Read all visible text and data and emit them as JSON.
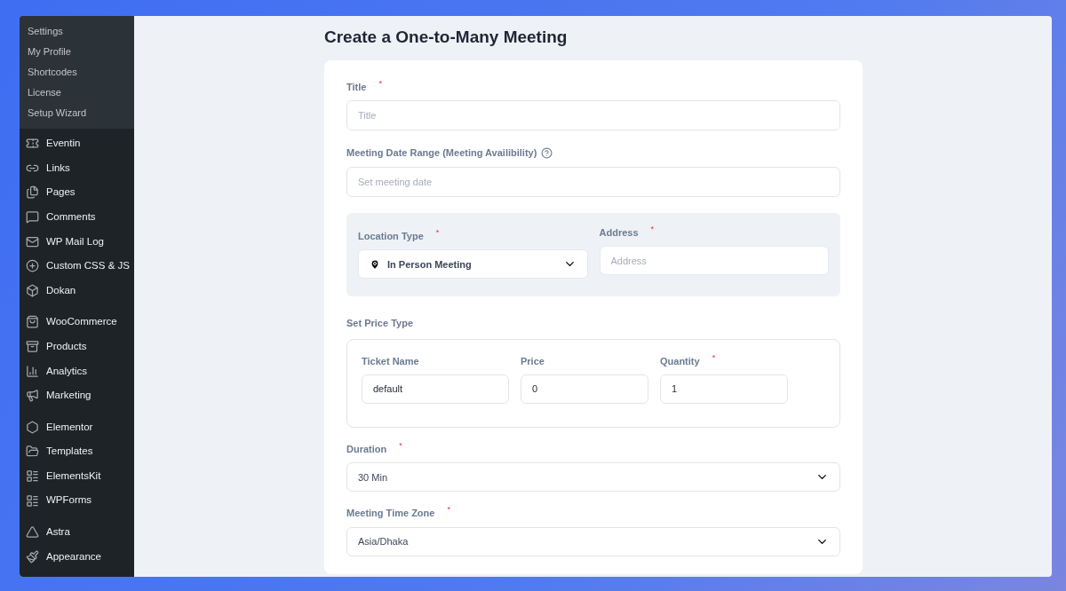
{
  "sidebar": {
    "submenu": [
      {
        "label": "Settings"
      },
      {
        "label": "My Profile"
      },
      {
        "label": "Shortcodes"
      },
      {
        "label": "License"
      },
      {
        "label": "Setup Wizard"
      }
    ],
    "groups": [
      [
        {
          "label": "Eventin"
        },
        {
          "label": "Links"
        },
        {
          "label": "Pages"
        },
        {
          "label": "Comments"
        },
        {
          "label": "WP Mail Log"
        },
        {
          "label": "Custom CSS & JS"
        },
        {
          "label": "Dokan"
        }
      ],
      [
        {
          "label": "WooCommerce"
        },
        {
          "label": "Products"
        },
        {
          "label": "Analytics"
        },
        {
          "label": "Marketing"
        }
      ],
      [
        {
          "label": "Elementor"
        },
        {
          "label": "Templates"
        },
        {
          "label": "ElementsKit"
        },
        {
          "label": "WPForms"
        }
      ],
      [
        {
          "label": "Astra"
        },
        {
          "label": "Appearance"
        }
      ]
    ]
  },
  "page": {
    "heading": "Create a One-to-Many Meeting"
  },
  "form": {
    "title_field": {
      "label": "Title",
      "required_mark": "*",
      "placeholder": "Title"
    },
    "date_field": {
      "label": "Meeting Date Range (Meeting Availibility)",
      "placeholder": "Set meeting date"
    },
    "location_type": {
      "label": "Location Type",
      "required_mark": "*",
      "value": "In Person Meeting"
    },
    "address": {
      "label": "Address",
      "required_mark": "*",
      "placeholder": "Address"
    },
    "price_type": {
      "label": "Set Price Type",
      "columns": [
        {
          "label": "Ticket Name",
          "value": "default"
        },
        {
          "label": "Price",
          "value": "0"
        },
        {
          "label": "Quantity",
          "required_mark": "*",
          "value": "1"
        }
      ]
    },
    "duration": {
      "label": "Duration",
      "required_mark": "*",
      "value": "30 Min"
    },
    "timezone": {
      "label": "Meeting Time Zone",
      "required_mark": "*",
      "value": "Asia/Dhaka"
    }
  }
}
